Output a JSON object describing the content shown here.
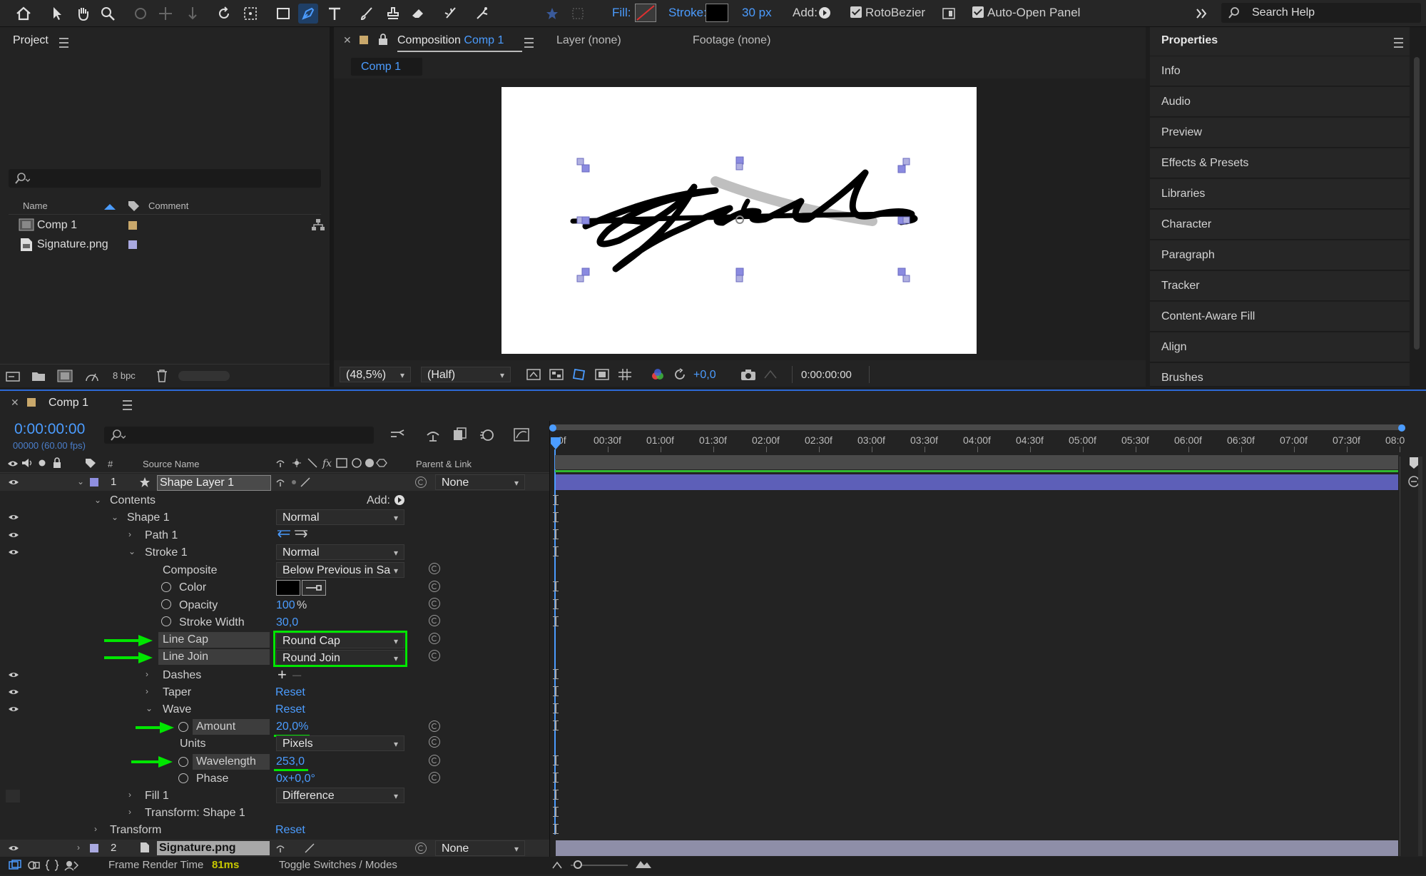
{
  "toolbar": {
    "fill_label": "Fill:",
    "stroke_label": "Stroke:",
    "stroke_width": "30 px",
    "add_label": "Add:",
    "rotobezier_label": "RotoBezier",
    "auto_open_label": "Auto-Open Panel",
    "search_placeholder": "Search Help"
  },
  "project": {
    "title": "Project",
    "col_name": "Name",
    "col_comment": "Comment",
    "items": [
      {
        "name": "Comp 1",
        "label_color": "#c9a86b"
      },
      {
        "name": "Signature.png",
        "label_color": "#a9a9e0"
      }
    ],
    "bpc": "8 bpc"
  },
  "composition": {
    "tab_prefix": "Composition",
    "tab_name": "Comp 1",
    "layer_tab": "Layer (none)",
    "footage_tab": "Footage (none)",
    "breadcrumb": "Comp 1",
    "zoom": "(48,5%)",
    "resolution": "(Half)",
    "exposure": "+0,0",
    "timecode": "0:00:00:00"
  },
  "properties": {
    "title": "Properties",
    "items": [
      "Info",
      "Audio",
      "Preview",
      "Effects & Presets",
      "Libraries",
      "Character",
      "Paragraph",
      "Tracker",
      "Content-Aware Fill",
      "Align",
      "Brushes"
    ]
  },
  "timeline": {
    "comp_name": "Comp 1",
    "timecode": "0:00:00:00",
    "frames": "00000 (60.00 fps)",
    "col_num": "#",
    "col_source": "Source Name",
    "col_parent": "Parent & Link",
    "ruler": [
      "0f",
      "00:30f",
      "01:00f",
      "01:30f",
      "02:00f",
      "02:30f",
      "03:00f",
      "03:30f",
      "04:00f",
      "04:30f",
      "05:00f",
      "05:30f",
      "06:00f",
      "06:30f",
      "07:00f",
      "07:30f",
      "08:0"
    ],
    "layer1": {
      "num": "1",
      "name": "Shape Layer 1",
      "parent": "None"
    },
    "contents": "Contents",
    "add": "Add:",
    "shape1": "Shape 1",
    "shape1_mode": "Normal",
    "path1": "Path 1",
    "stroke1": "Stroke 1",
    "stroke1_mode": "Normal",
    "composite": "Composite",
    "composite_val": "Below Previous in Sa",
    "color": "Color",
    "opacity": "Opacity",
    "opacity_val": "100",
    "opacity_unit": "%",
    "stroke_width": "Stroke Width",
    "stroke_width_val": "30,0",
    "line_cap": "Line Cap",
    "line_cap_val": "Round Cap",
    "line_join": "Line Join",
    "line_join_val": "Round Join",
    "dashes": "Dashes",
    "taper": "Taper",
    "taper_reset": "Reset",
    "wave": "Wave",
    "wave_reset": "Reset",
    "amount": "Amount",
    "amount_val": "20,0%",
    "units": "Units",
    "units_val": "Pixels",
    "wavelength": "Wavelength",
    "wavelength_val": "253,0",
    "phase": "Phase",
    "phase_val": "0x+0,0°",
    "fill1": "Fill 1",
    "fill1_mode": "Difference",
    "transform_shape": "Transform: Shape 1",
    "transform": "Transform",
    "transform_reset": "Reset",
    "layer2": {
      "num": "2",
      "name": "Signature.png",
      "parent": "None"
    },
    "render_label": "Frame Render Time",
    "render_time": "81ms",
    "toggle": "Toggle Switches / Modes"
  },
  "colors": {
    "accent": "#4b9cff",
    "highlight": "#00e600",
    "layer_bar": "#5d5fb8"
  }
}
